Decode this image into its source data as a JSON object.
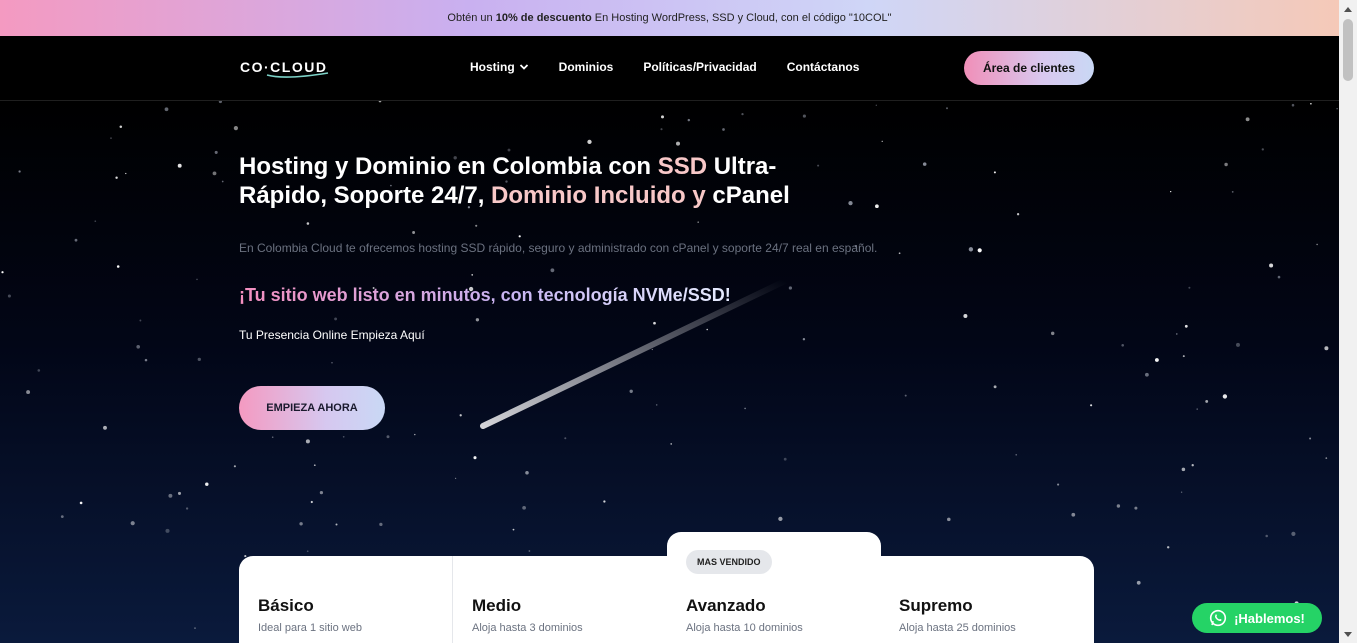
{
  "promo": {
    "prefix": "Obtén un ",
    "highlight": "10% de descuento",
    "suffix": " En Hosting WordPress, SSD y Cloud, con el código \"10COL\""
  },
  "header": {
    "logo_text": "CO·CLOUD",
    "nav": [
      {
        "label": "Hosting",
        "icon": "chevron-down-icon"
      },
      {
        "label": "Dominios"
      },
      {
        "label": "Políticas/Privacidad"
      },
      {
        "label": "Contáctanos"
      }
    ],
    "client_button": "Área de clientes"
  },
  "hero": {
    "title_part1": "Hosting y Dominio en Colombia con ",
    "title_accent1": "SSD",
    "title_part2": " Ultra-Rápido, Soporte 24/7, ",
    "title_accent2": "Dominio Incluido y",
    "title_part3": " cPanel",
    "description": "En Colombia Cloud te ofrecemos hosting SSD rápido, seguro y administrado con cPanel y soporte 24/7 real en español.",
    "tagline": "¡Tu sitio web listo en minutos, con tecnología NVMe/SSD!",
    "subtitle": "Tu Presencia Online Empieza Aquí",
    "cta": "EMPIEZA AHORA"
  },
  "plans": [
    {
      "name": "Básico",
      "subtitle": "Ideal para 1 sitio web"
    },
    {
      "name": "Medio",
      "subtitle": "Aloja hasta 3 dominios"
    },
    {
      "name": "Avanzado",
      "subtitle": "Aloja hasta 10 dominios",
      "badge": "MAS VENDIDO"
    },
    {
      "name": "Supremo",
      "subtitle": "Aloja hasta 25 dominios"
    }
  ],
  "whatsapp": {
    "label": "¡Hablemos!",
    "icon": "whatsapp-icon",
    "color": "#25d366"
  },
  "colors": {
    "accent_pink": "#f49ac1",
    "accent_lavender": "#c9b0f0",
    "hero_bg": "#020617"
  }
}
